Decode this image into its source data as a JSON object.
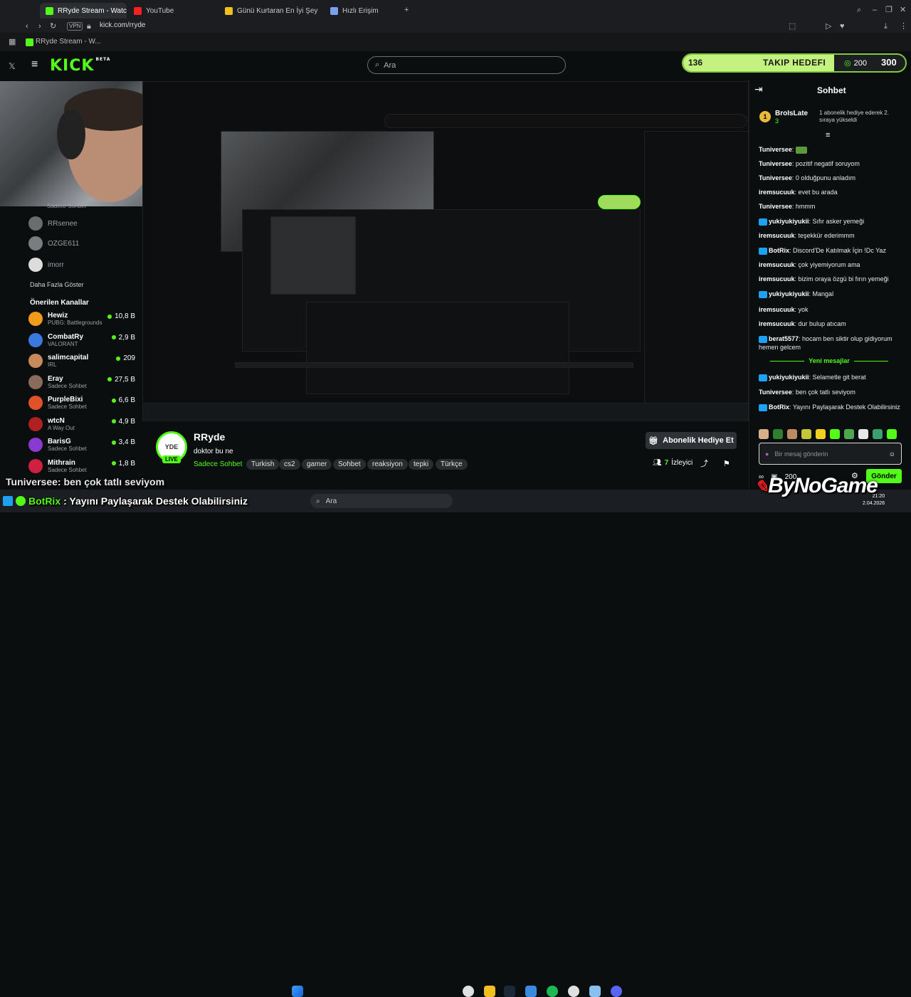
{
  "browser": {
    "tabs": [
      {
        "label": "RRyde Stream - Watch Li",
        "active": true
      },
      {
        "label": "YouTube",
        "active": false
      },
      {
        "label": "Günü Kurtaran En İyi Şey",
        "active": false
      },
      {
        "label": "Hızlı Erişim",
        "active": false
      }
    ],
    "vpn_label": "VPN",
    "url": "kick.com/rryde",
    "history_item": "RRyde Stream - W..."
  },
  "header": {
    "logo": "KICK",
    "logo_tag": "BETA",
    "search_placeholder": "Ara"
  },
  "goal": {
    "current": "136",
    "title": "TAKIP HEDEFI",
    "target": "200",
    "end_value": "300",
    "progress": 0.68
  },
  "sidebar": {
    "followed": [
      {
        "name": "RRsenee",
        "sub": ""
      },
      {
        "name": "OZGE611",
        "sub": ""
      },
      {
        "name": "imorr",
        "sub": ""
      }
    ],
    "top_sub": "Sadece Sohbet",
    "show_more": "Daha Fazla Göster",
    "recommended_title": "Önerilen Kanallar",
    "recommended": [
      {
        "name": "Hewiz",
        "sub": "PUBG: Battlegrounds",
        "viewers": "10,8 B",
        "color": "#f29a1a"
      },
      {
        "name": "CombatRy",
        "sub": "VALORANT",
        "viewers": "2,9 B",
        "color": "#3a7ae0"
      },
      {
        "name": "salimcapital",
        "sub": "IRL",
        "viewers": "209",
        "color": "#c88a5a"
      },
      {
        "name": "Eray",
        "sub": "Sadece Sohbet",
        "viewers": "27,5 B",
        "color": "#8a6b5a"
      },
      {
        "name": "PurpleBixi",
        "sub": "Sadece Sohbet",
        "viewers": "6,6 B",
        "color": "#e0532a"
      },
      {
        "name": "wtcN",
        "sub": "A Way Out",
        "viewers": "4,9 B",
        "color": "#b02020"
      },
      {
        "name": "BarisG",
        "sub": "Sadece Sohbet",
        "viewers": "3,4 B",
        "color": "#8a3ad0"
      },
      {
        "name": "Mithrain",
        "sub": "Sadece Sohbet",
        "viewers": "1,8 B",
        "color": "#d02040"
      }
    ]
  },
  "channel": {
    "avatar_text": "YDE",
    "live": "LIVE",
    "name": "RRyde",
    "title": "doktor bu ne",
    "category": "Sadece Sohbet",
    "tags": [
      "Turkish",
      "cs2",
      "gamer",
      "Sohbet",
      "reaksiyon",
      "tepki",
      "Türkçe"
    ],
    "gift_button": "Abonelik Hediye Et",
    "viewers_count": "7",
    "viewers_label": "İzleyici"
  },
  "chat": {
    "title": "Sohbet",
    "gifter": {
      "name": "BroIsLate",
      "count": "3",
      "rank_note": "1 abonelik hediye ederek 2. sıraya yükseldi"
    },
    "messages": [
      {
        "user": "Tuniversee",
        "text": ""
      },
      {
        "user": "Tuniversee",
        "text": "pozitif negatif soruyom"
      },
      {
        "user": "Tuniversee",
        "text": "0 olduğpunu anladım"
      },
      {
        "user": "iremsucuuk",
        "text": "evet bu arada"
      },
      {
        "user": "Tuniversee",
        "text": "hmmm"
      },
      {
        "user": "yukiyukiyukii",
        "text": "Sıfır asker yemeği"
      },
      {
        "user": "iremsucuuk",
        "text": "teşekkür ederimmm"
      },
      {
        "user": "BotRix",
        "text": "Discord'De Katılmak İçin !Dc Yaz"
      },
      {
        "user": "iremsucuuk",
        "text": "çok yiyemiyorum ama"
      },
      {
        "user": "iremsucuuk",
        "text": "bizim oraya özgü bi fırın yemeği"
      },
      {
        "user": "yukiyukiyukii",
        "text": "Mangal"
      },
      {
        "user": "iremsucuuk",
        "text": "yok"
      },
      {
        "user": "iremsucuuk",
        "text": "dur bulup atıcam"
      },
      {
        "user": "berat5577",
        "text": "hocam ben siktir olup gidiyorum hemen gelcem"
      }
    ],
    "new_messages": "Yeni mesajlar",
    "new": [
      {
        "user": "yukiyukiyukii",
        "text": "Selametle git berat"
      },
      {
        "user": "Tuniversee",
        "text": "ben çok tatlı seviyom"
      },
      {
        "user": "BotRix",
        "text": "Yayını Paylaşarak Destek Olabilirsiniz"
      }
    ],
    "input_placeholder": "Bir mesaj gönderin",
    "points": "200",
    "send": "Gönder"
  },
  "overlays": {
    "line1_user": "Tuniversee",
    "line1_text": ": ben çok tatlı seviyom",
    "line2_user": "BotRix",
    "line2_text": ": Yayını Paylaşarak Destek Olabilirsiniz",
    "watermark_by": "By",
    "watermark_name": "NoGame"
  },
  "taskbar": {
    "search": "Ara",
    "time": "21:20",
    "date": "2.04.2026"
  },
  "colors": {
    "kick_green": "#53fc18",
    "bg": "#0b0e0f"
  }
}
